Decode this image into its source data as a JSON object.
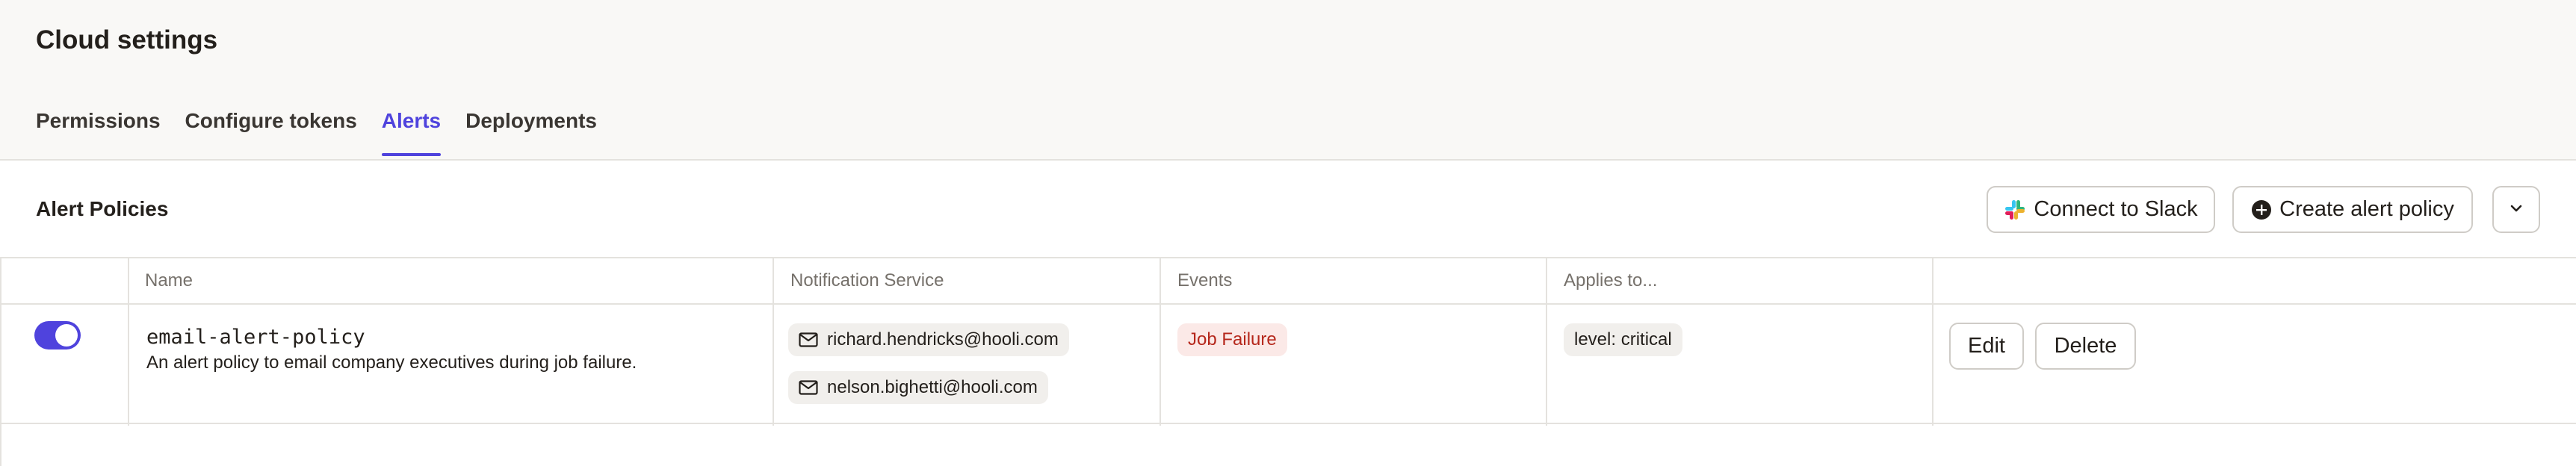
{
  "header": {
    "title": "Cloud settings",
    "tabs": [
      {
        "label": "Permissions",
        "active": false
      },
      {
        "label": "Configure tokens",
        "active": false
      },
      {
        "label": "Alerts",
        "active": true
      },
      {
        "label": "Deployments",
        "active": false
      }
    ]
  },
  "section": {
    "title": "Alert Policies",
    "connect_slack_label": "Connect to Slack",
    "create_policy_label": "Create alert policy",
    "more_icon": "chevron-down-icon"
  },
  "table": {
    "columns": [
      "",
      "Name",
      "Notification Service",
      "Events",
      "Applies to...",
      ""
    ],
    "rows": [
      {
        "enabled": true,
        "name": "email-alert-policy",
        "description": "An alert policy to email company executives during job failure.",
        "notification_emails": [
          "richard.hendricks@hooli.com",
          "nelson.bighetti@hooli.com"
        ],
        "events": [
          "Job Failure"
        ],
        "applies_to": "level: critical",
        "edit_label": "Edit",
        "delete_label": "Delete"
      }
    ]
  },
  "colors": {
    "accent": "#4f43dd",
    "event_bg": "#fbe9e7",
    "event_text": "#b5271b"
  }
}
